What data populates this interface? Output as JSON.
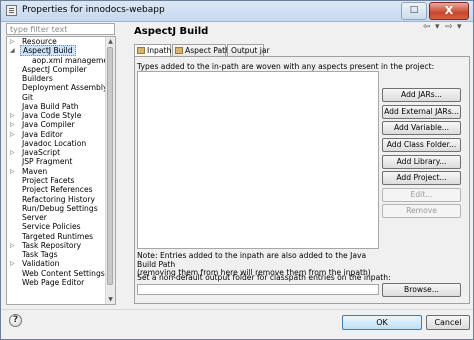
{
  "window": {
    "title": "Properties for innodocs-webapp",
    "close_glyph": "X",
    "max_glyph": "□"
  },
  "filter": {
    "placeholder": "type filter text"
  },
  "tree": {
    "items": [
      {
        "label": "Resource",
        "arrow": "▷",
        "child": false,
        "selected": false
      },
      {
        "label": "AspectJ Build",
        "arrow": "◢",
        "child": false,
        "selected": true
      },
      {
        "label": "aop.xml management",
        "arrow": "",
        "child": true,
        "selected": false
      },
      {
        "label": "AspectJ Compiler",
        "arrow": "",
        "child": false,
        "selected": false
      },
      {
        "label": "Builders",
        "arrow": "",
        "child": false,
        "selected": false
      },
      {
        "label": "Deployment Assembly",
        "arrow": "",
        "child": false,
        "selected": false
      },
      {
        "label": "Git",
        "arrow": "",
        "child": false,
        "selected": false
      },
      {
        "label": "Java Build Path",
        "arrow": "",
        "child": false,
        "selected": false
      },
      {
        "label": "Java Code Style",
        "arrow": "▷",
        "child": false,
        "selected": false
      },
      {
        "label": "Java Compiler",
        "arrow": "▷",
        "child": false,
        "selected": false
      },
      {
        "label": "Java Editor",
        "arrow": "▷",
        "child": false,
        "selected": false
      },
      {
        "label": "Javadoc Location",
        "arrow": "",
        "child": false,
        "selected": false
      },
      {
        "label": "JavaScript",
        "arrow": "▷",
        "child": false,
        "selected": false
      },
      {
        "label": "JSP Fragment",
        "arrow": "",
        "child": false,
        "selected": false
      },
      {
        "label": "Maven",
        "arrow": "▷",
        "child": false,
        "selected": false
      },
      {
        "label": "Project Facets",
        "arrow": "",
        "child": false,
        "selected": false
      },
      {
        "label": "Project References",
        "arrow": "",
        "child": false,
        "selected": false
      },
      {
        "label": "Refactoring History",
        "arrow": "",
        "child": false,
        "selected": false
      },
      {
        "label": "Run/Debug Settings",
        "arrow": "",
        "child": false,
        "selected": false
      },
      {
        "label": "Server",
        "arrow": "",
        "child": false,
        "selected": false
      },
      {
        "label": "Service Policies",
        "arrow": "",
        "child": false,
        "selected": false
      },
      {
        "label": "Targeted Runtimes",
        "arrow": "",
        "child": false,
        "selected": false
      },
      {
        "label": "Task Repository",
        "arrow": "▷",
        "child": false,
        "selected": false
      },
      {
        "label": "Task Tags",
        "arrow": "",
        "child": false,
        "selected": false
      },
      {
        "label": "Validation",
        "arrow": "▷",
        "child": false,
        "selected": false
      },
      {
        "label": "Web Content Settings",
        "arrow": "",
        "child": false,
        "selected": false
      },
      {
        "label": "Web Page Editor",
        "arrow": "",
        "child": false,
        "selected": false
      }
    ]
  },
  "page": {
    "title": "AspectJ Build",
    "nav_back": "⇦",
    "nav_fwd": "⇨",
    "nav_menu": "▾",
    "tabs": [
      "Inpath",
      "Aspect Path",
      "Output jar"
    ],
    "description": "Types added to the in-path are woven with any aspects present in the project:",
    "buttons": [
      "Add JARs...",
      "Add External JARs...",
      "Add Variable...",
      "Add Class Folder...",
      "Add Library...",
      "Add Project...",
      "Edit...",
      "Remove"
    ],
    "note_line1": "Note: Entries added to the inpath are also added to the Java Build Path",
    "note_line2": "(removing them from here will remove them from the inpath)",
    "output_label": "Set a non-default output folder for classpath entries on the inpath:",
    "browse": "Browse..."
  },
  "footer": {
    "help": "?",
    "ok": "OK",
    "cancel": "Cancel"
  }
}
